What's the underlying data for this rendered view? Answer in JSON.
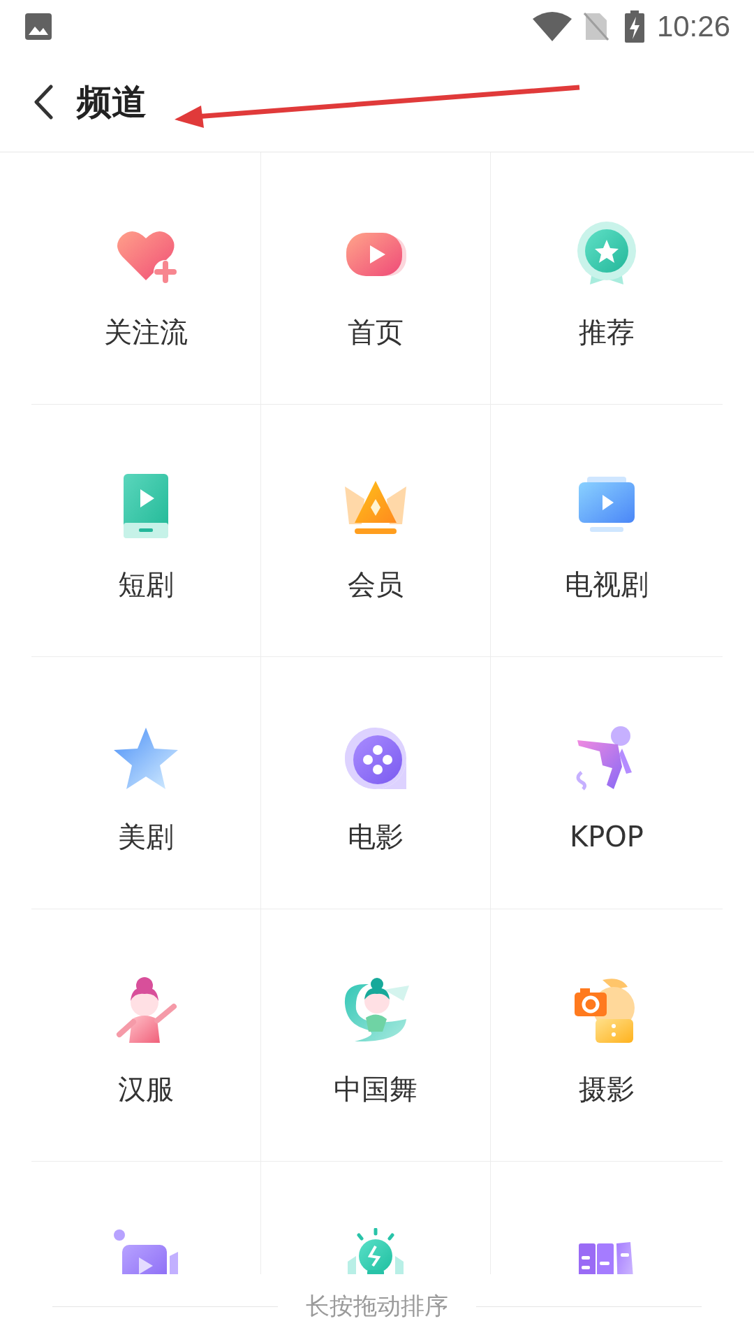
{
  "status_bar": {
    "time": "10:26"
  },
  "header": {
    "title": "频道"
  },
  "channels": [
    {
      "kind": "labeled",
      "label": "关注流"
    },
    {
      "kind": "labeled",
      "label": "首页"
    },
    {
      "kind": "labeled",
      "label": "推荐"
    },
    {
      "kind": "labeled",
      "label": "短剧"
    },
    {
      "kind": "labeled",
      "label": "会员"
    },
    {
      "kind": "labeled",
      "label": "电视剧"
    },
    {
      "kind": "labeled",
      "label": "美剧"
    },
    {
      "kind": "labeled",
      "label": "电影"
    },
    {
      "kind": "labeled",
      "label": "KPOP"
    },
    {
      "kind": "labeled",
      "label": "汉服"
    },
    {
      "kind": "labeled",
      "label": "中国舞"
    },
    {
      "kind": "labeled",
      "label": "摄影"
    },
    {
      "kind": "cut_off"
    },
    {
      "kind": "cut_off"
    },
    {
      "kind": "cut_off"
    }
  ],
  "footer": {
    "hint": "长按拖动排序"
  }
}
